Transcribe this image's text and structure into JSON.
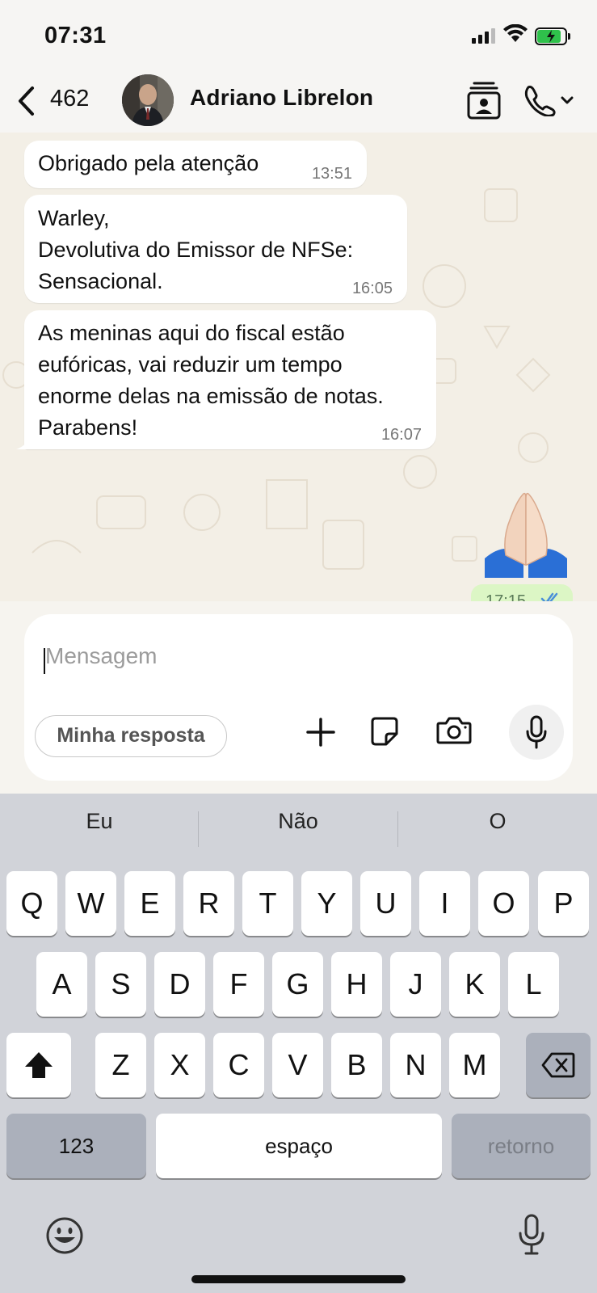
{
  "status_bar": {
    "time": "07:31",
    "battery_level": 0.85
  },
  "header": {
    "back_count": "462",
    "contact_name": "Adriano Librelon"
  },
  "messages": [
    {
      "text": "Obrigado pela atenção",
      "time": "13:51"
    },
    {
      "text": "Warley,\nDevolutiva do Emissor de NFSe:\nSensacional.",
      "time": "16:05"
    },
    {
      "text": "As meninas aqui do fiscal estão\neufóricas, vai reduzir um tempo\nenorme delas na emissão de notas.\nParabens!",
      "time": "16:07"
    }
  ],
  "sent_message": {
    "emoji": "🙏🏻",
    "time": "17:15"
  },
  "composer": {
    "placeholder": "Mensagem",
    "reply_chip": "Minha resposta"
  },
  "keyboard": {
    "suggestions": [
      "Eu",
      "Não",
      "O"
    ],
    "row1": [
      "Q",
      "W",
      "E",
      "R",
      "T",
      "Y",
      "U",
      "I",
      "O",
      "P"
    ],
    "row2": [
      "A",
      "S",
      "D",
      "F",
      "G",
      "H",
      "J",
      "K",
      "L"
    ],
    "row3": [
      "Z",
      "X",
      "C",
      "V",
      "B",
      "N",
      "M"
    ],
    "numbers_key": "123",
    "space_key": "espaço",
    "return_key": "retorno"
  }
}
